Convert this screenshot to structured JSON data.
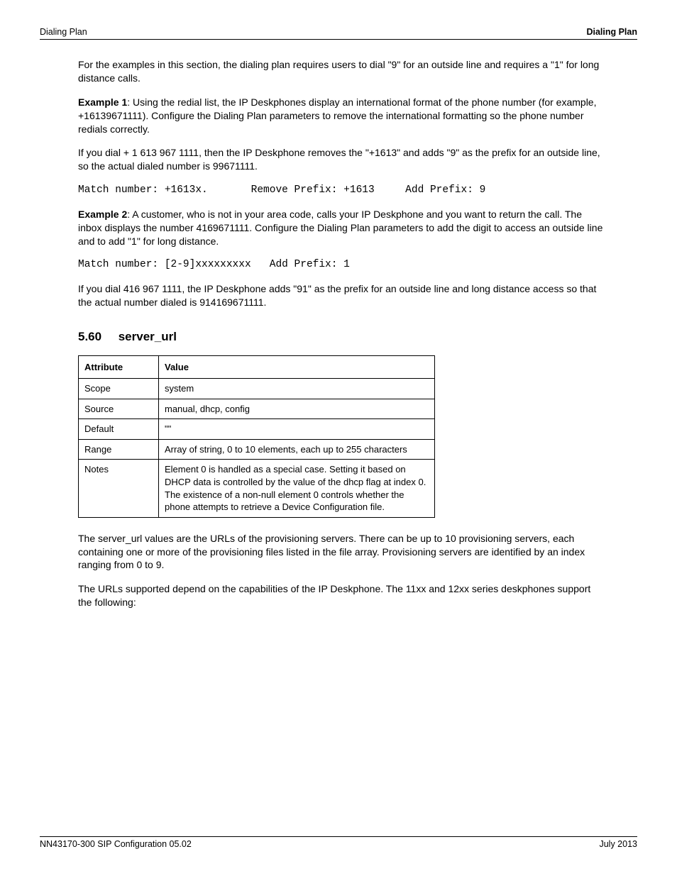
{
  "header": {
    "left": "Dialing Plan",
    "right": "Dialing Plan"
  },
  "p1": "For the examples in this section, the dialing plan requires users to dial \"9\" for an outside line and requires a \"1\" for long distance calls.",
  "p2a": "Example 1",
  "p2b": ": Using the redial list, the IP Deskphones display an international format of the phone number (for example, +16139671111). Configure the Dialing Plan parameters to remove the international formatting so the phone number redials correctly.",
  "p3": "If you dial + 1 613 967 1111, then the IP Deskphone removes the \"+1613\" and adds \"9\" as the prefix for an outside line, so the actual dialed number is 99671111.",
  "mono1": "Match number: +1613x.       Remove Prefix: +1613     Add Prefix: 9",
  "p4a": "Example 2",
  "p4b": ": A customer, who is not in your area code, calls your IP Deskphone and you want to return the call. The inbox displays the number 4169671111. Configure the Dialing Plan parameters to add the digit to access an outside line and to add \"1\" for long distance.",
  "mono2": "Match number: [2-9]xxxxxxxxx   Add Prefix: 1",
  "p5": "If you dial 416 967 1111, the IP Deskphone adds \"91\" as the prefix for an outside line and long distance access so that the actual number dialed is 914169671111.",
  "sec_num": "5.60",
  "sec_title": "server_url",
  "table": {
    "h1": "Attribute",
    "h2": "Value",
    "rows": [
      [
        "Scope",
        "system"
      ],
      [
        "Source",
        "manual, dhcp, config"
      ],
      [
        "Default",
        "\"\""
      ],
      [
        "Range",
        "Array of string, 0 to 10 elements, each up to 255 characters"
      ],
      [
        "Notes",
        "Element 0 is handled as a special case. Setting it based on DHCP data is controlled by the value of the dhcp flag at index 0. The existence of a non-null element 0 controls whether the phone attempts to retrieve a Device Configuration file."
      ]
    ]
  },
  "p6": "The server_url values are the URLs of the provisioning servers. There can be up to 10 provisioning servers, each containing one or more of the provisioning files listed in the file array. Provisioning servers are identified by an index ranging from 0 to 9.",
  "p7": "The URLs supported depend on the capabilities of the IP Deskphone. The 11xx and 12xx series deskphones support the following:",
  "footer": {
    "left": "NN43170-300 SIP Configuration 05.02",
    "right": "July 2013"
  }
}
